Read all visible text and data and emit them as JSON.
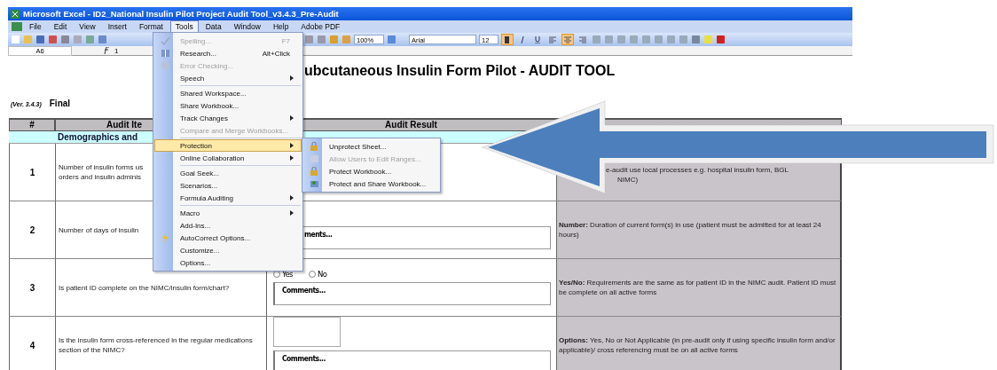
{
  "window": {
    "title": "Microsoft Excel - ID2_National Insulin Pilot Project Audit Tool_v3.4.3_Pre-Audit"
  },
  "menu_bar": [
    {
      "label": "File",
      "selected": false
    },
    {
      "label": "Edit",
      "selected": false
    },
    {
      "label": "View",
      "selected": false
    },
    {
      "label": "Insert",
      "selected": false
    },
    {
      "label": "Format",
      "selected": false
    },
    {
      "label": "Tools",
      "selected": true
    },
    {
      "label": "Data",
      "selected": false
    },
    {
      "label": "Window",
      "selected": false
    },
    {
      "label": "Help",
      "selected": false
    },
    {
      "label": "Adobe PDF",
      "selected": false
    }
  ],
  "toolbar": {
    "zoom": "100%",
    "font": "Arial",
    "size": "12",
    "toggles": [
      {
        "kind": "bold",
        "selected": true
      },
      {
        "kind": "italic",
        "selected": false
      },
      {
        "kind": "underline",
        "selected": false
      },
      {
        "kind": "align-left",
        "selected": false
      },
      {
        "kind": "center",
        "selected": true
      },
      {
        "kind": "align-right",
        "selected": false
      }
    ]
  },
  "formula_bar": {
    "cell": "A6",
    "value": "1"
  },
  "sheet": {
    "title": "ubcutaneous Insulin Form Pilot - AUDIT TOOL",
    "version": "(Ver. 3.4.3)",
    "status": "Final",
    "columns": [
      "#",
      "Audit Ite",
      "Audit Result"
    ],
    "section": "Demographics and",
    "rows": [
      {
        "number": "1",
        "item": [
          "Number of insulin forms us",
          "orders and insulin adminis"
        ],
        "guidance": [
          "e-audit use local processes e.g. hospital insulin form, BGL",
          "NIMC)"
        ]
      },
      {
        "number": "2",
        "item": [
          "Number of days of insulin"
        ],
        "result": {
          "kind": "comments",
          "comments": "ments..."
        },
        "guidance": [
          "**Number:** Duration of current form(s) in use (patient must be admitted for at least 24 hours)"
        ]
      },
      {
        "number": "3",
        "item": [
          "Is patient ID complete on the NIMC/insulin form/chart?"
        ],
        "result": {
          "kind": "yesno",
          "options": [
            {
              "label": "Yes",
              "selected": false
            },
            {
              "label": "No",
              "selected": false
            }
          ],
          "comments": "Comments..."
        },
        "guidance": [
          "**Yes/No:** Requirements are the same as for patient ID in the NIMC audit. Patient ID must be complete on all active forms"
        ]
      },
      {
        "number": "4",
        "item": [
          "Is the insulin form cross-referenced in the regular medications section of the NIMC?"
        ],
        "result": {
          "kind": "select",
          "comments": "Comments..."
        },
        "guidance": [
          "**Options:** Yes, No or Not Applicable (in pre-audit only if using specific insulin form and/or applicable)/ cross referencing must be on all active forms"
        ]
      }
    ]
  },
  "tools_menu": [
    {
      "kind": "item",
      "label": "Spelling...",
      "shortcut": "F7",
      "disabled": true,
      "submenu": false,
      "selected": false
    },
    {
      "kind": "item",
      "label": "Research...",
      "shortcut": "Alt+Click",
      "disabled": false,
      "submenu": false,
      "selected": false
    },
    {
      "kind": "item",
      "label": "Error Checking...",
      "disabled": true,
      "submenu": false,
      "selected": false
    },
    {
      "kind": "item",
      "label": "Speech",
      "disabled": false,
      "submenu": true,
      "selected": false
    },
    {
      "kind": "separator"
    },
    {
      "kind": "item",
      "label": "Shared Workspace...",
      "disabled": false,
      "submenu": false,
      "selected": false
    },
    {
      "kind": "item",
      "label": "Share Workbook...",
      "disabled": false,
      "submenu": false,
      "selected": false
    },
    {
      "kind": "item",
      "label": "Track Changes",
      "disabled": false,
      "submenu": true,
      "selected": false
    },
    {
      "kind": "item",
      "label": "Compare and Merge Workbooks...",
      "disabled": true,
      "submenu": false,
      "selected": false
    },
    {
      "kind": "separator"
    },
    {
      "kind": "item",
      "label": "Protection",
      "disabled": false,
      "submenu": true,
      "selected": true
    },
    {
      "kind": "item",
      "label": "Online Collaboration",
      "disabled": false,
      "submenu": true,
      "selected": false
    },
    {
      "kind": "separator"
    },
    {
      "kind": "item",
      "label": "Goal Seek...",
      "disabled": false,
      "submenu": false,
      "selected": false
    },
    {
      "kind": "item",
      "label": "Scenarios...",
      "disabled": false,
      "submenu": false,
      "selected": false
    },
    {
      "kind": "item",
      "label": "Formula Auditing",
      "disabled": false,
      "submenu": true,
      "selected": false
    },
    {
      "kind": "separator"
    },
    {
      "kind": "item",
      "label": "Macro",
      "disabled": false,
      "submenu": true,
      "selected": false
    },
    {
      "kind": "item",
      "label": "Add-Ins...",
      "disabled": false,
      "submenu": false,
      "selected": false
    },
    {
      "kind": "item",
      "label": "AutoCorrect Options...",
      "disabled": false,
      "submenu": false,
      "selected": false
    },
    {
      "kind": "item",
      "label": "Customize...",
      "disabled": false,
      "submenu": false,
      "selected": false
    },
    {
      "kind": "item",
      "label": "Options...",
      "disabled": false,
      "submenu": false,
      "selected": false
    }
  ],
  "protection_submenu": [
    {
      "label": "Unprotect Sheet...",
      "disabled": false
    },
    {
      "label": "Allow Users to Edit Ranges...",
      "disabled": true
    },
    {
      "label": "Protect Workbook...",
      "disabled": false
    },
    {
      "label": "Protect and Share Workbook...",
      "disabled": false
    }
  ]
}
